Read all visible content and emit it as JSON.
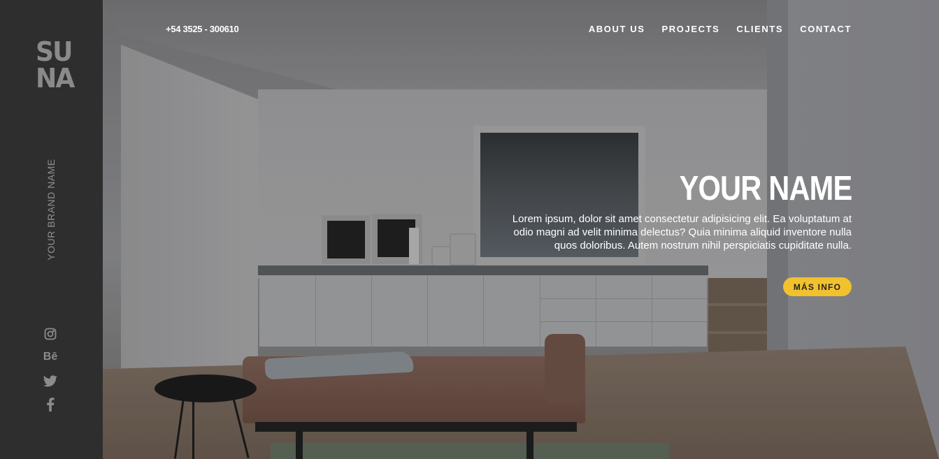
{
  "sidebar": {
    "logo_line1": "SU",
    "logo_line2": "NA",
    "brand_name": "YOUR BRAND NAME",
    "social": [
      {
        "icon": "instagram-icon"
      },
      {
        "icon": "behance-icon",
        "glyph": "Bē"
      },
      {
        "icon": "twitter-icon"
      },
      {
        "icon": "facebook-icon"
      }
    ]
  },
  "header": {
    "phone": "+54 3525 - 300610",
    "nav": [
      "ABOUT US",
      "PROJECTS",
      "CLIENTS",
      "CONTACT"
    ]
  },
  "hero": {
    "title": "YOUR NAME",
    "description": "Lorem ipsum, dolor sit amet consectetur adipisicing elit. Ea voluptatum at odio magni ad velit minima delectus? Quia minima aliquid inventore nulla quos doloribus. Autem nostrum nihil perspiciatis cupiditate nulla.",
    "cta_label": "MÁS INFO"
  },
  "colors": {
    "sidebar_bg": "#2e2e2e",
    "accent": "#f2c12e",
    "text_light": "#ffffff",
    "muted": "#8c8c8c"
  }
}
